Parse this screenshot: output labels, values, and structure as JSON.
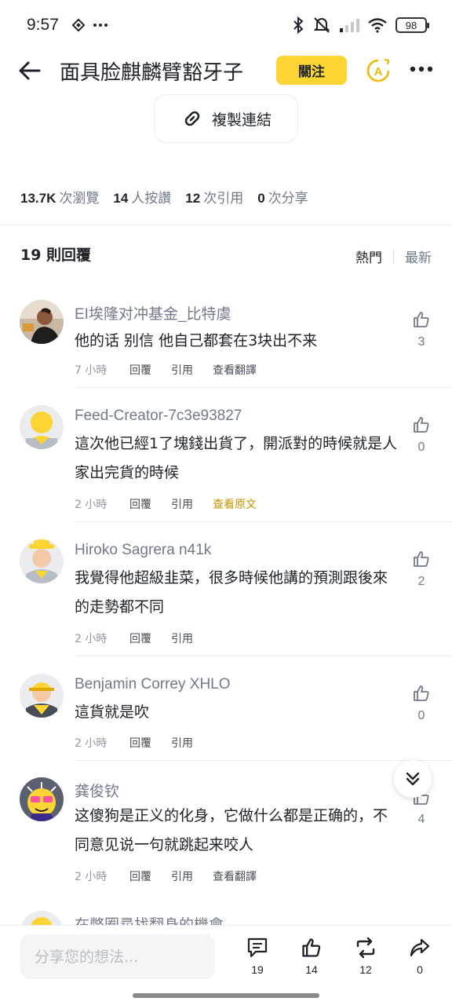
{
  "status_bar": {
    "time": "9:57",
    "battery": "98"
  },
  "header": {
    "title": "面具脸麒麟臂豁牙子",
    "follow_label": "關注"
  },
  "copy_link": {
    "label": "複製連結"
  },
  "stats": [
    {
      "value": "13.7K",
      "label": "次瀏覽"
    },
    {
      "value": "14",
      "label": "人按讚"
    },
    {
      "value": "12",
      "label": "次引用"
    },
    {
      "value": "0",
      "label": "次分享"
    }
  ],
  "replies": {
    "heading": "19 則回覆",
    "sort_hot": "熱門",
    "sort_new": "最新"
  },
  "comments": [
    {
      "name": "EI埃隆对冲基金_比特虞",
      "text": "他的话 别信 他自己都套在3块出不来",
      "time": "7 小時",
      "reply": "回覆",
      "quote": "引用",
      "translate": "查看翻譯",
      "likes": "3"
    },
    {
      "name": "Feed-Creator-7c3e93827",
      "text": "這次他已經1了塊錢出貨了，開派對的時候就是人家出完貨的時候",
      "time": "2 小時",
      "reply": "回覆",
      "quote": "引用",
      "translate": "查看原文",
      "likes": "0"
    },
    {
      "name": "Hiroko Sagrera n41k",
      "text": "我覺得他超級韭菜，很多時候他講的預測跟後來的走勢都不同",
      "time": "2 小時",
      "reply": "回覆",
      "quote": "引用",
      "likes": "2"
    },
    {
      "name": "Benjamin Correy XHLO",
      "text": "這貨就是吹",
      "time": "2 小時",
      "reply": "回覆",
      "quote": "引用",
      "likes": "0"
    },
    {
      "name": "龚俊钦",
      "text": "这傻狗是正义的化身，它做什么都是正确的，不同意见说一句就跳起来咬人",
      "time": "2 小時",
      "reply": "回覆",
      "quote": "引用",
      "translate": "查看翻譯",
      "likes": "4"
    },
    {
      "name": "在幣圈尋找翻身的機會"
    }
  ],
  "bottom_bar": {
    "placeholder": "分享您的想法...",
    "comments_count": "19",
    "likes_count": "14",
    "reposts_count": "12",
    "shares_count": "0"
  },
  "icons": {
    "status_left": [
      "binance-icon",
      "ellipsis-icon"
    ],
    "status_right": [
      "bluetooth-icon",
      "mute-icon",
      "signal-icon",
      "wifi-icon",
      "battery-icon"
    ]
  },
  "colors": {
    "accent": "#fcd535",
    "text_primary": "#1e2329",
    "text_secondary": "#707a8a",
    "gold_link": "#c99400"
  }
}
